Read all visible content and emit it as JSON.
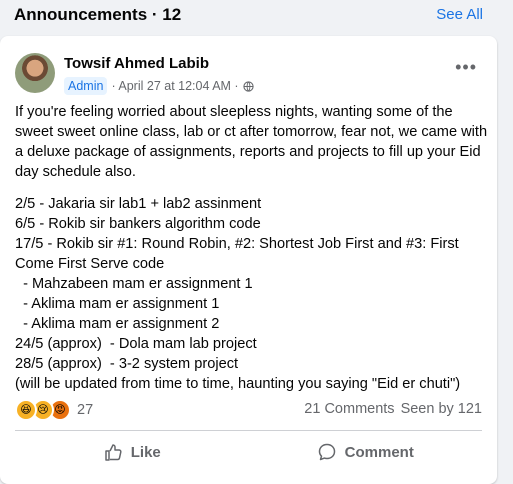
{
  "header": {
    "title": "Announcements · 12",
    "see_all": "See All"
  },
  "post": {
    "author": "Towsif Ahmed Labib",
    "badge": "Admin",
    "date": "· April 27 at 12:04 AM ·",
    "intro": "If you're feeling worried about sleepless nights, wanting some of the sweet sweet online class, lab or ct after tomorrow, fear not, we came with a deluxe package of assignments, reports and projects to fill up your Eid day schedule also.",
    "lines": [
      "2/5 - Jakaria sir lab1 + lab2 assinment",
      "6/5 - Rokib sir bankers algorithm code",
      "17/5 - Rokib sir #1: Round Robin, #2: Shortest Job First and #3: First",
      "Come First Serve code",
      "  - Mahzabeen mam er assignment 1",
      "  - Aklima mam er assignment 1",
      "  - Aklima mam er assignment 2",
      "24/5 (approx)  - Dola mam lab project",
      "28/5 (approx)  - 3-2 system project",
      "(will be updated from time to time, haunting you saying \"Eid er chuti\")"
    ],
    "reaction_count": "27",
    "comments": "21 Comments",
    "seen_by": "Seen by 121",
    "like_label": "Like",
    "comment_label": "Comment"
  },
  "colors": {
    "accent": "#1b74e4",
    "muted": "#65676b",
    "background": "#f0f2f5"
  },
  "icons": {
    "globe": "globe-icon",
    "more": "more-options-icon",
    "like": "thumbs-up-icon",
    "comment": "comment-bubble-icon",
    "reactions": [
      "haha-react-icon",
      "sad-react-icon",
      "angry-react-icon"
    ]
  }
}
